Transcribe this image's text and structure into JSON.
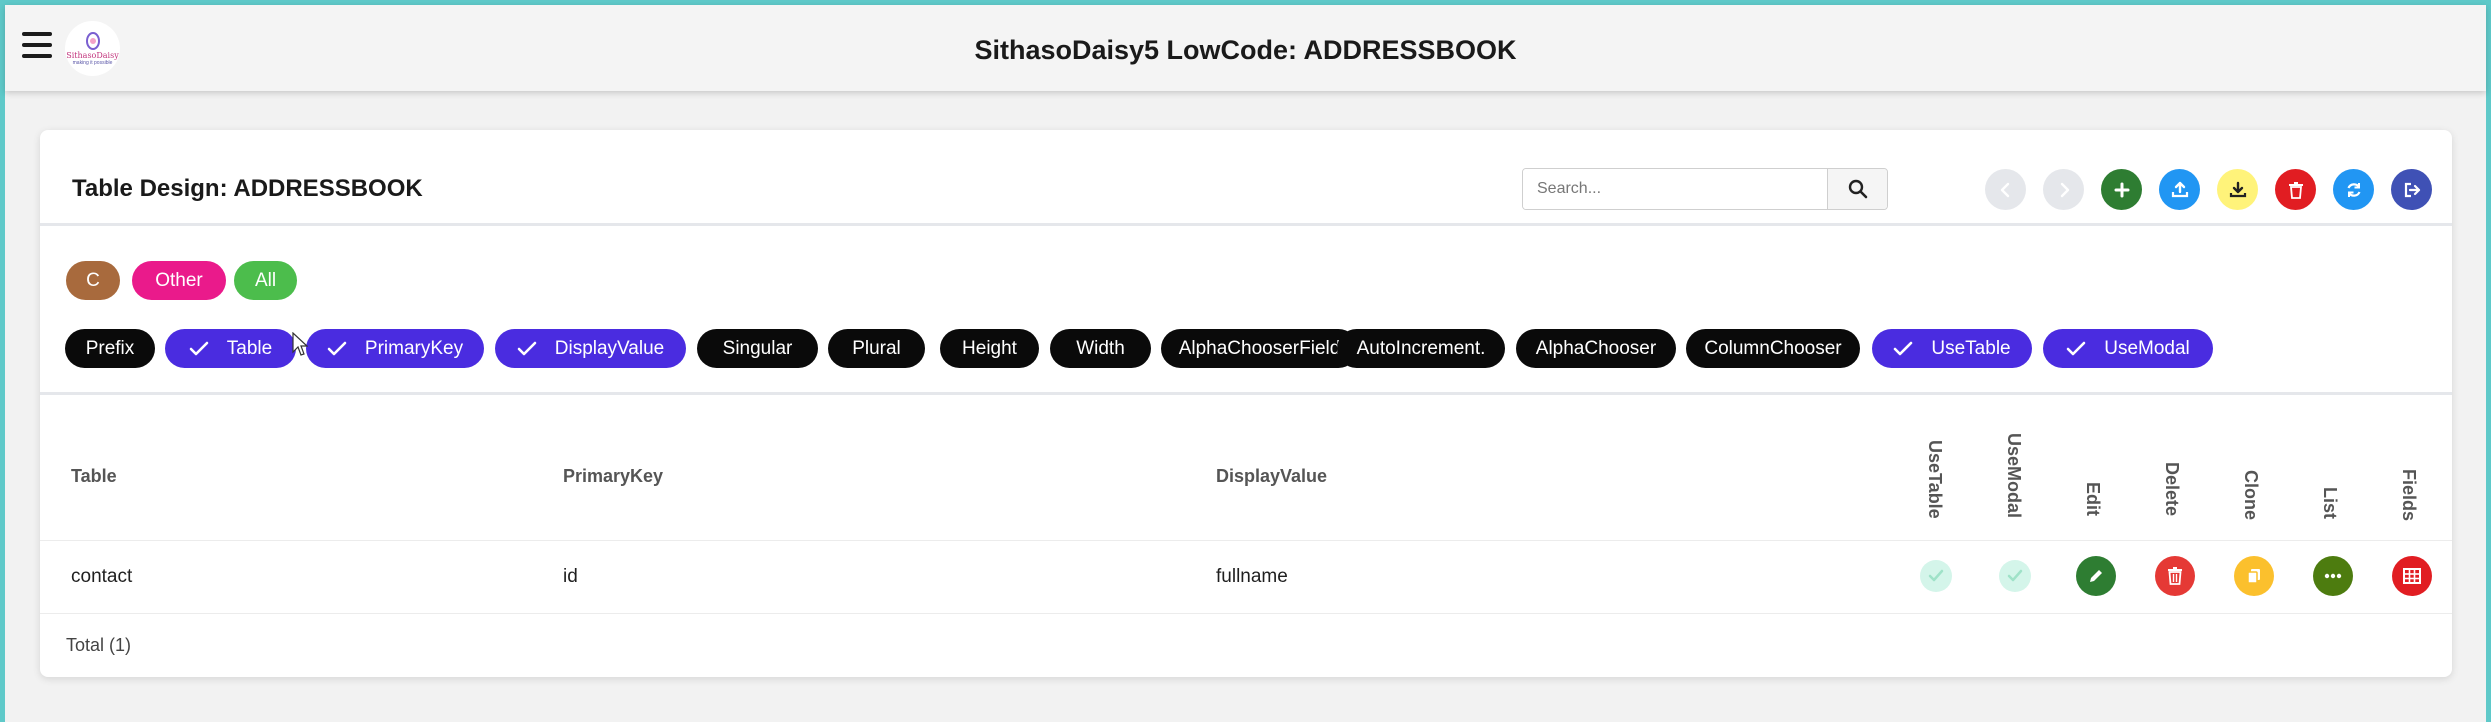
{
  "app": {
    "title": "SithasoDaisy5 LowCode: ADDRESSBOOK",
    "logo_brand": "SithasoDaisy",
    "logo_tagline": "making it possible"
  },
  "card": {
    "title": "Table Design: ADDRESSBOOK",
    "search": {
      "placeholder": "Search...",
      "value": ""
    },
    "toolbar": [
      {
        "name": "back-button",
        "icon": "chevron-left-icon",
        "color": "#e5e7eb"
      },
      {
        "name": "forward-button",
        "icon": "chevron-right-icon",
        "color": "#e5e7eb"
      },
      {
        "name": "add-button",
        "icon": "plus-icon",
        "color": "#2e7d32"
      },
      {
        "name": "upload-button",
        "icon": "upload-icon",
        "color": "#2196f3"
      },
      {
        "name": "download-button",
        "icon": "download-icon",
        "color": "#fff37a"
      },
      {
        "name": "delete-all-button",
        "icon": "trash-icon",
        "color": "#e11d22"
      },
      {
        "name": "refresh-button",
        "icon": "refresh-icon",
        "color": "#2196f3"
      },
      {
        "name": "exit-button",
        "icon": "sign-out-icon",
        "color": "#3f51b5"
      }
    ]
  },
  "filter_badges": [
    {
      "label": "C",
      "color": "#a86a3d"
    },
    {
      "label": "Other",
      "color": "#ea1a8b"
    },
    {
      "label": "All",
      "color": "#4cbd4c"
    }
  ],
  "column_toggles": [
    {
      "label": "Prefix",
      "checked": false
    },
    {
      "label": "Table",
      "checked": true
    },
    {
      "label": "PrimaryKey",
      "checked": true
    },
    {
      "label": "DisplayValue",
      "checked": true
    },
    {
      "label": "Singular",
      "checked": false
    },
    {
      "label": "Plural",
      "checked": false
    },
    {
      "label": "Height",
      "checked": false
    },
    {
      "label": "Width",
      "checked": false
    },
    {
      "label": "AlphaChooserField",
      "checked": false
    },
    {
      "label": "AutoIncrement.",
      "checked": false
    },
    {
      "label": "AlphaChooser",
      "checked": false
    },
    {
      "label": "ColumnChooser",
      "checked": false
    },
    {
      "label": "UseTable",
      "checked": true
    },
    {
      "label": "UseModal",
      "checked": true
    }
  ],
  "toggle_colors": {
    "checked": "#4a2ce0",
    "unchecked": "#0a0a0a"
  },
  "table": {
    "headers": {
      "table": "Table",
      "primary_key": "PrimaryKey",
      "display_value": "DisplayValue",
      "use_table": "UseTable",
      "use_modal": "UseModal",
      "edit": "Edit",
      "delete": "Delete",
      "clone": "Clone",
      "list": "List",
      "fields": "Fields"
    },
    "rows": [
      {
        "table": "contact",
        "primary_key": "id",
        "display_value": "fullname",
        "use_table": true,
        "use_modal": true
      }
    ],
    "action_colors": {
      "edit": "#2e7d32",
      "delete": "#e53935",
      "clone": "#fbc02d",
      "list": "#4d7c0f",
      "fields": "#e11d22"
    },
    "total": "Total (1)"
  }
}
